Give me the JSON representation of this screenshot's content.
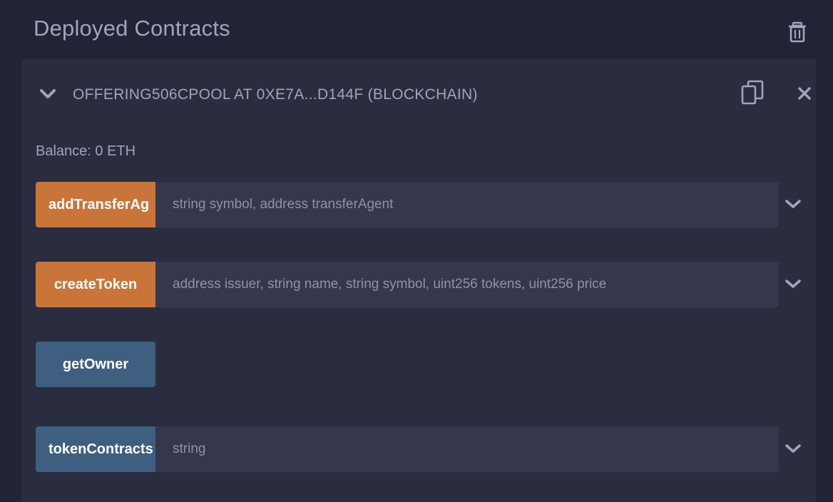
{
  "panel": {
    "title": "Deployed Contracts",
    "trash_icon": "trash-icon"
  },
  "instance": {
    "title": "OFFERING506CPOOL AT 0XE7A...D144F (BLOCKCHAIN)",
    "balance": "Balance: 0 ETH",
    "icons": {
      "collapse": "chevron-down-icon",
      "copy": "copy-icon",
      "close": "close-icon"
    },
    "functions": [
      {
        "name": "addTransferAg",
        "kind": "transact",
        "placeholder": "string symbol, address transferAgent"
      },
      {
        "name": "createToken",
        "kind": "transact",
        "placeholder": "address issuer, string name, string symbol, uint256 tokens, uint256 price"
      },
      {
        "name": "getOwner",
        "kind": "call",
        "placeholder": ""
      },
      {
        "name": "tokenContracts",
        "kind": "call",
        "placeholder": "string"
      }
    ]
  },
  "colors": {
    "background": "#222336",
    "card": "#2a2c3f",
    "input": "#35384c",
    "transact": "#c97539",
    "call": "#3e5f7f",
    "text_muted": "#a2a3bd"
  }
}
